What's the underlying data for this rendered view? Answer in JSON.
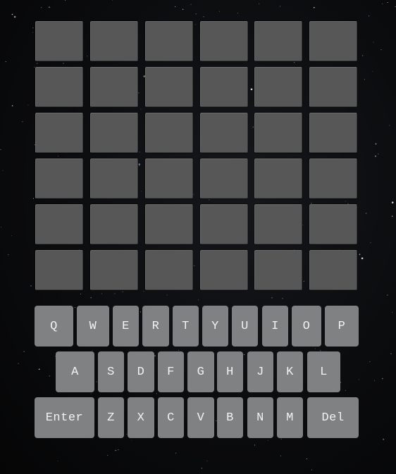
{
  "board": {
    "rows": 6,
    "cols": 6,
    "tiles": [
      [
        "",
        "",
        "",
        "",
        "",
        ""
      ],
      [
        "",
        "",
        "",
        "",
        "",
        ""
      ],
      [
        "",
        "",
        "",
        "",
        "",
        ""
      ],
      [
        "",
        "",
        "",
        "",
        "",
        ""
      ],
      [
        "",
        "",
        "",
        "",
        "",
        ""
      ],
      [
        "",
        "",
        "",
        "",
        "",
        ""
      ]
    ]
  },
  "keyboard": {
    "row1": [
      "Q",
      "W",
      "E",
      "R",
      "T",
      "Y",
      "U",
      "I",
      "O",
      "P"
    ],
    "row2": [
      "A",
      "S",
      "D",
      "F",
      "G",
      "H",
      "J",
      "K",
      "L"
    ],
    "row3": [
      "Enter",
      "Z",
      "X",
      "C",
      "V",
      "B",
      "N",
      "M",
      "Del"
    ]
  },
  "colors": {
    "background": "#0b0c0e",
    "tile": "#575757",
    "key": "#7f8183",
    "key_text": "#f2f2f2"
  }
}
